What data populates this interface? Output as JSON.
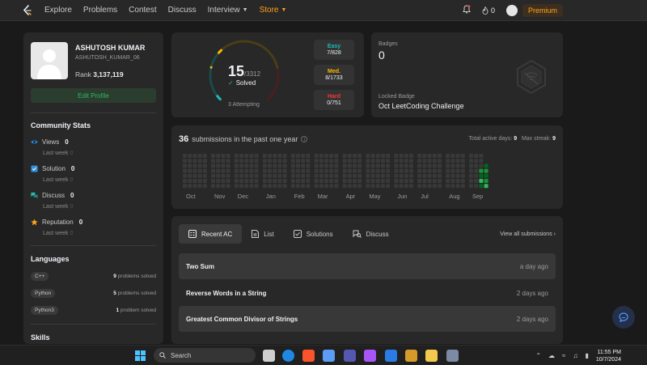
{
  "nav": {
    "links": [
      "Explore",
      "Problems",
      "Contest",
      "Discuss",
      "Interview",
      "Store"
    ],
    "streak": "0",
    "premium": "Premium"
  },
  "profile": {
    "name": "ASHUTOSH KUMAR",
    "username": "ASHUTOSH_KUMAR_06",
    "rank_label": "Rank",
    "rank": "3,137,119",
    "edit_button": "Edit Profile"
  },
  "community": {
    "title": "Community Stats",
    "last_week_label": "Last week",
    "items": [
      {
        "label": "Views",
        "value": "0",
        "last_week": "0",
        "icon": "eye-icon",
        "color": "#1f8ef1"
      },
      {
        "label": "Solution",
        "value": "0",
        "last_week": "0",
        "icon": "check-square-icon",
        "color": "#2f8fd8"
      },
      {
        "label": "Discuss",
        "value": "0",
        "last_week": "0",
        "icon": "chat-bubbles-icon",
        "color": "#2cbbad"
      },
      {
        "label": "Reputation",
        "value": "0",
        "last_week": "0",
        "icon": "star-icon",
        "color": "#ffa116"
      }
    ]
  },
  "languages": {
    "title": "Languages",
    "items": [
      {
        "name": "C++",
        "count": "9",
        "suffix": "problems solved"
      },
      {
        "name": "Python",
        "count": "5",
        "suffix": "problems solved"
      },
      {
        "name": "Python3",
        "count": "1",
        "suffix": "problem solved"
      }
    ]
  },
  "skills": {
    "title": "Skills"
  },
  "solved": {
    "count": "15",
    "total": "/3312",
    "solved_label": "Solved",
    "attempting": "3 Attempting",
    "difficulty": [
      {
        "label": "Easy",
        "value": "7/828",
        "color": "#1cbaba"
      },
      {
        "label": "Med.",
        "value": "8/1733",
        "color": "#ffb700"
      },
      {
        "label": "Hard",
        "value": "0/751",
        "color": "#f63737"
      }
    ],
    "progress": {
      "easy": 7,
      "medium": 8,
      "hard": 0,
      "total": 3312
    }
  },
  "badges": {
    "label": "Badges",
    "count": "0",
    "locked_label": "Locked Badge",
    "locked_name": "Oct LeetCoding Challenge"
  },
  "submissions": {
    "count": "36",
    "label": "submissions in the past one year",
    "active_label": "Total active days:",
    "active_days": "9",
    "streak_label": "Max streak:",
    "max_streak": "9",
    "months": [
      "Oct",
      "Nov",
      "Dec",
      "Jan",
      "Feb",
      "Mar",
      "Apr",
      "May",
      "Jun",
      "Jul",
      "Aug",
      "Sep"
    ]
  },
  "recent": {
    "tabs": [
      "Recent AC",
      "List",
      "Solutions",
      "Discuss"
    ],
    "view_all": "View all submissions",
    "items": [
      {
        "title": "Two Sum",
        "time": "a day ago"
      },
      {
        "title": "Reverse Words in a String",
        "time": "2 days ago"
      },
      {
        "title": "Greatest Common Divisor of Strings",
        "time": "2 days ago"
      }
    ]
  },
  "taskbar": {
    "search": "Search",
    "time": "11:55 PM",
    "date": "10/7/2024"
  },
  "colors": {
    "accent": "#ffa116",
    "green": "#2cbb5d",
    "panel": "#282828",
    "background": "#1a1a1a"
  }
}
